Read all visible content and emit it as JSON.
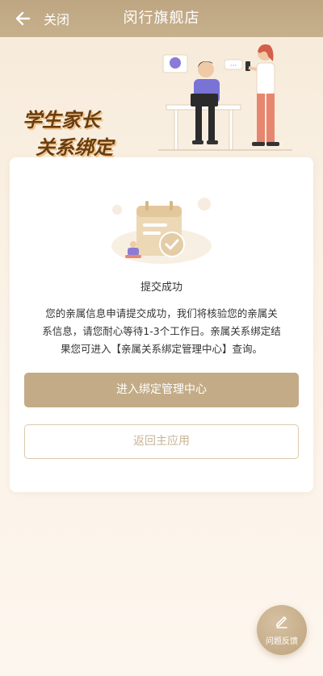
{
  "header": {
    "close_label": "关闭",
    "title": "闵行旗舰店"
  },
  "hero": {
    "title_line1": "学生家长",
    "title_line2": "关系绑定"
  },
  "result": {
    "status": "提交成功",
    "description": "您的亲属信息申请提交成功，我们将核验您的亲属关系信息，请您耐心等待1-3个工作日。亲属关系绑定结果您可进入【亲属关系绑定管理中心】查询。",
    "primary_button": "进入绑定管理中心",
    "secondary_button": "返回主应用"
  },
  "feedback": {
    "label": "问题反馈"
  },
  "colors": {
    "header_bg": "#c2ab86",
    "primary": "#c2ab86",
    "hero_title": "#6a3e0f"
  }
}
